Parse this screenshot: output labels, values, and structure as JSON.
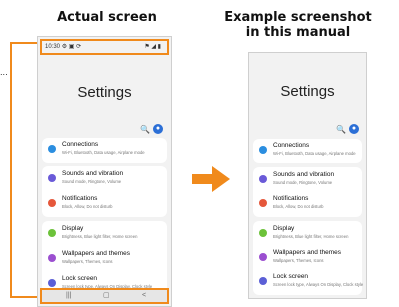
{
  "captions": {
    "actual": "Actual screen",
    "example_line1": "Example screenshot",
    "example_line2": "in this manual"
  },
  "side_note": "...",
  "status_bar": {
    "time": "10:30",
    "left_icons": "⚙ ▣ ⟳",
    "right_icons": "⚑ ◢ ▮"
  },
  "nav_bar": {
    "recents": "|||",
    "home": "▢",
    "back": "<"
  },
  "screen": {
    "title": "Settings",
    "search_glyph": "🔍",
    "avatar_glyph": "●",
    "items": [
      {
        "label": "Connections",
        "sub": "Wi-Fi, Bluetooth, Data usage, Airplane mode",
        "color": "#2b8ee0",
        "icon": "wifi-icon"
      },
      {
        "label": "Sounds and vibration",
        "sub": "Sound mode, Ringtone, Volume",
        "color": "#6a5ad8",
        "icon": "speaker-icon"
      },
      {
        "label": "Notifications",
        "sub": "Block, Allow, Do not disturb",
        "color": "#e5573b",
        "icon": "bell-icon"
      },
      {
        "label": "Display",
        "sub": "Brightness, Blue light filter, Home screen",
        "color": "#6cc23a",
        "icon": "sun-icon"
      },
      {
        "label": "Wallpapers and themes",
        "sub": "Wallpapers, Themes, Icons",
        "color": "#9b4fd0",
        "icon": "brush-icon"
      },
      {
        "label": "Lock screen",
        "sub": "Screen lock type, Always On Display, Clock style",
        "color": "#5b5fd6",
        "icon": "lock-icon"
      }
    ]
  },
  "colors": {
    "accent": "#f08a1c",
    "avatar": "#2c6fd6"
  }
}
